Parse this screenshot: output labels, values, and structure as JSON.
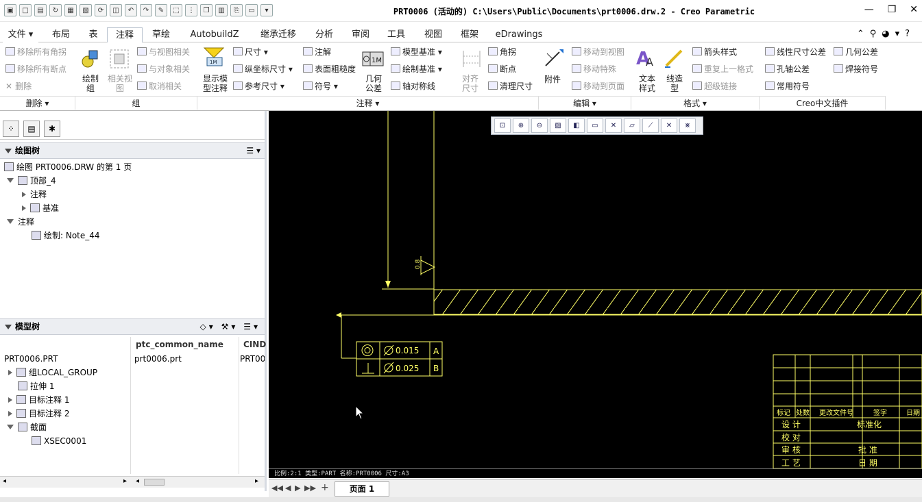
{
  "window": {
    "title": "PRT0006 (活动的) C:\\Users\\Public\\Documents\\prt0006.drw.2 - Creo Parametric",
    "minimize": "—",
    "restore": "❐",
    "close": "✕"
  },
  "tabs": [
    "文件 ▾",
    "布局",
    "表",
    "注释",
    "草绘",
    "AutobuildZ",
    "继承迁移",
    "分析",
    "审阅",
    "工具",
    "视图",
    "框架",
    "eDrawings"
  ],
  "active_tab": "注释",
  "ribbon": {
    "delete_group": {
      "items": [
        "移除所有角拐",
        "移除所有断点",
        "删除"
      ],
      "label": "删除 ▾"
    },
    "group_group": {
      "big": "绘制组",
      "big2": "相关视图",
      "items": [
        "与视图相关",
        "与对象相关",
        "取消相关"
      ],
      "label": "组"
    },
    "annot_group": {
      "big_show": "显示模型注释",
      "col1": [
        "尺寸 ▾",
        "纵坐标尺寸 ▾",
        "参考尺寸 ▾"
      ],
      "col2": [
        "注解",
        "表面粗糙度",
        "符号 ▾"
      ],
      "big_geo": "几何公差",
      "col3": [
        "模型基准 ▾",
        "绘制基准 ▾",
        "轴对称线"
      ],
      "big_align": "对齐尺寸",
      "col4": [
        "角拐",
        "断点",
        "清理尺寸"
      ],
      "label": "注释 ▾"
    },
    "edit_group": {
      "big": "附件",
      "items": [
        "移动到视图",
        "移动特殊",
        "移动到页面"
      ],
      "label": "编辑 ▾"
    },
    "format_group": {
      "big1": "文本样式",
      "big2": "线造型",
      "items": [
        "箭头样式",
        "重复上一格式",
        "超级链接"
      ],
      "label": "格式 ▾"
    },
    "creo_group": {
      "items": [
        "线性尺寸公差",
        "几何公差",
        "孔轴公差",
        "焊接符号",
        "常用符号"
      ],
      "label": "Creo中文插件"
    }
  },
  "drawing_tree": {
    "header": "绘图树",
    "rows": [
      "绘图 PRT0006.DRW 的第 1 页",
      "顶部_4",
      "注释",
      "基准",
      "注释",
      "绘制: Note_44"
    ]
  },
  "model_tree": {
    "header": "模型树",
    "columns": [
      "ptc_common_name",
      "CIND"
    ],
    "root": {
      "name": "PRT0006.PRT",
      "common": "prt0006.prt",
      "cind": "PRT00"
    },
    "rows": [
      "组LOCAL_GROUP",
      "拉伸 1",
      "目标注释 1",
      "目标注释 2",
      "截面",
      "XSEC0001"
    ]
  },
  "drawing": {
    "gtol1_value": "0.015",
    "gtol1_datum": "A",
    "gtol2_value": "0.025",
    "gtol2_datum": "B",
    "weld_label": "0.8",
    "title_block": {
      "header": [
        "标记",
        "处数",
        "更改文件号",
        "签字",
        "日期"
      ],
      "rows": [
        [
          "设 计",
          "标准化"
        ],
        [
          "校 对",
          ""
        ],
        [
          "审 核",
          "批 准"
        ],
        [
          "工 艺",
          "日 期"
        ]
      ]
    }
  },
  "status_line": "比例:2:1     类型:PART   名称:PRT0006   尺寸:A3",
  "page_tab": "页面 1"
}
